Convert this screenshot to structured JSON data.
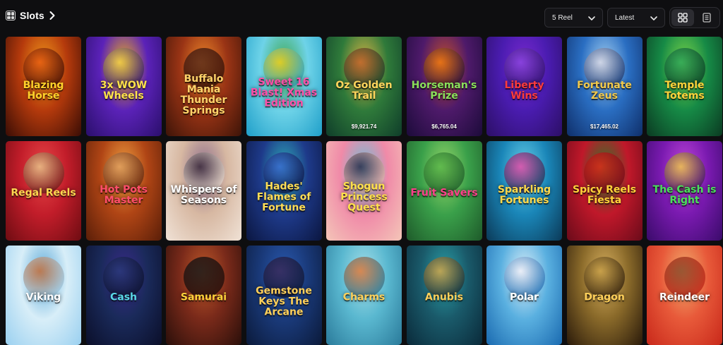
{
  "header": {
    "title": "Slots",
    "filters": [
      {
        "id": "reel",
        "value": "5 Reel"
      },
      {
        "id": "sort",
        "value": "Latest"
      }
    ],
    "view": {
      "active": "grid",
      "options": [
        "grid-view-icon",
        "list-view-icon"
      ]
    }
  },
  "games": [
    {
      "name": "Blazing Horse",
      "bg": [
        "#3a0d05",
        "#b53a0c",
        "#f29a1c"
      ],
      "text": "#ffd12a",
      "fig": "#e85c12"
    },
    {
      "name": "3x WOW Wheels",
      "bg": [
        "#2a0f6b",
        "#5b22b8",
        "#f0b21a"
      ],
      "text": "#ffe34a",
      "fig": "#f3d24b"
    },
    {
      "name": "Buffalo Mania Thunder Springs",
      "bg": [
        "#3d1408",
        "#9a3415",
        "#f08a2a"
      ],
      "text": "#ffd36a",
      "fig": "#5a2b1a"
    },
    {
      "name": "Sweet 16 Blast! Xmas Edition",
      "bg": [
        "#1f9fc9",
        "#6ed3e8",
        "#3fa64a"
      ],
      "text": "#ff4fa8",
      "fig": "#f6d21d"
    },
    {
      "name": "Oz Golden Trail",
      "bg": [
        "#0f3d2a",
        "#2f7a3a",
        "#e0b646"
      ],
      "text": "#ffd45c",
      "fig": "#c0632b",
      "jackpot": "$9,921.74"
    },
    {
      "name": "Horseman's Prize",
      "bg": [
        "#1c0b3a",
        "#4e1a6a",
        "#c8512a"
      ],
      "text": "#8ae05a",
      "fig": "#f07a12",
      "jackpot": "$6,765.04"
    },
    {
      "name": "Liberty Wins",
      "bg": [
        "#2c0f66",
        "#4a1cb0",
        "#7a2ad0"
      ],
      "text": "#ff3b3b",
      "fig": "#8c46e0"
    },
    {
      "name": "Fortunate Zeus",
      "bg": [
        "#0f2f6a",
        "#2a6ec2",
        "#a8d3f2"
      ],
      "text": "#f2c94a",
      "fig": "#d9d9e6",
      "jackpot": "$17,465.02"
    },
    {
      "name": "Temple Totems",
      "bg": [
        "#0b3a22",
        "#168a46",
        "#7ed84a"
      ],
      "text": "#ffd23a",
      "fig": "#2fa85a"
    },
    {
      "name": "Regal Reels",
      "bg": [
        "#6e0c12",
        "#c21d2a",
        "#e84848"
      ],
      "text": "#ffd750",
      "fig": "#e9c48a"
    },
    {
      "name": "Hot Pots Master",
      "bg": [
        "#5a1e08",
        "#b04515",
        "#f0a242"
      ],
      "text": "#ff4d6a",
      "fig": "#e0a060"
    },
    {
      "name": "Whispers of Seasons",
      "bg": [
        "#f0e2d6",
        "#d7b8a2",
        "#8a6a8a"
      ],
      "text": "#ffffff",
      "fig": "#3a2a3a"
    },
    {
      "name": "Hades' Flames of Fortune",
      "bg": [
        "#0b1640",
        "#1e3a8a",
        "#2fb0b8"
      ],
      "text": "#ffdd55",
      "fig": "#3a6ad0"
    },
    {
      "name": "Shogun Princess Quest",
      "bg": [
        "#f4c6b8",
        "#f08aa8",
        "#6ac0d8"
      ],
      "text": "#ffe04a",
      "fig": "#2a2a48"
    },
    {
      "name": "Fruit Savers",
      "bg": [
        "#1e5a2a",
        "#3aa04a",
        "#9ad86a"
      ],
      "text": "#ff3f8a",
      "fig": "#5ab84a"
    },
    {
      "name": "Sparkling Fortunes",
      "bg": [
        "#0b3a58",
        "#1a86b8",
        "#6ad0e8"
      ],
      "text": "#ffd84a",
      "fig": "#e84aa8"
    },
    {
      "name": "Spicy Reels Fiesta",
      "bg": [
        "#6a0b1a",
        "#c0182a",
        "#2a7a2a"
      ],
      "text": "#ffd23a",
      "fig": "#e02a1a"
    },
    {
      "name": "The Cash is Right",
      "bg": [
        "#3a0b6a",
        "#7a1ab0",
        "#c048d8"
      ],
      "text": "#4ae05a",
      "fig": "#f0c848"
    },
    {
      "name": "Viking",
      "bg": [
        "#9ad0f0",
        "#d8eef8",
        "#5aa8d8"
      ],
      "text": "#ffffff",
      "fig": "#c8703a"
    },
    {
      "name": "Cash",
      "bg": [
        "#0b0f2a",
        "#1a2a5a",
        "#3a2a8a"
      ],
      "text": "#5ad8e8",
      "fig": "#2a3a7a"
    },
    {
      "name": "Samurai",
      "bg": [
        "#2a0f0a",
        "#7a2a1a",
        "#c05a2a"
      ],
      "text": "#ffd23a",
      "fig": "#1a1a1a"
    },
    {
      "name": "Gemstone Keys The Arcane",
      "bg": [
        "#0b1a3a",
        "#1a3a7a",
        "#2a5ab0"
      ],
      "text": "#ffd05a",
      "fig": "#3a2a5a"
    },
    {
      "name": "Charms",
      "bg": [
        "#2a7a9a",
        "#5ab8d0",
        "#a8e0e8"
      ],
      "text": "#ffd05a",
      "fig": "#e07a3a"
    },
    {
      "name": "Anubis",
      "bg": [
        "#0a2a3a",
        "#1a5a6a",
        "#2aa0a8"
      ],
      "text": "#ffd05a",
      "fig": "#d4a84a"
    },
    {
      "name": "Polar",
      "bg": [
        "#1a6ab0",
        "#5ab0e0",
        "#e0f0f8"
      ],
      "text": "#ffffff",
      "fig": "#f0f0f8"
    },
    {
      "name": "Dragon",
      "bg": [
        "#2a1a0a",
        "#8a6a2a",
        "#d8b060"
      ],
      "text": "#ffd05a",
      "fig": "#c8a048"
    },
    {
      "name": "Reindeer",
      "bg": [
        "#c8281a",
        "#e85a3a",
        "#f0b070"
      ],
      "text": "#ffffff",
      "fig": "#8a4a2a"
    }
  ]
}
